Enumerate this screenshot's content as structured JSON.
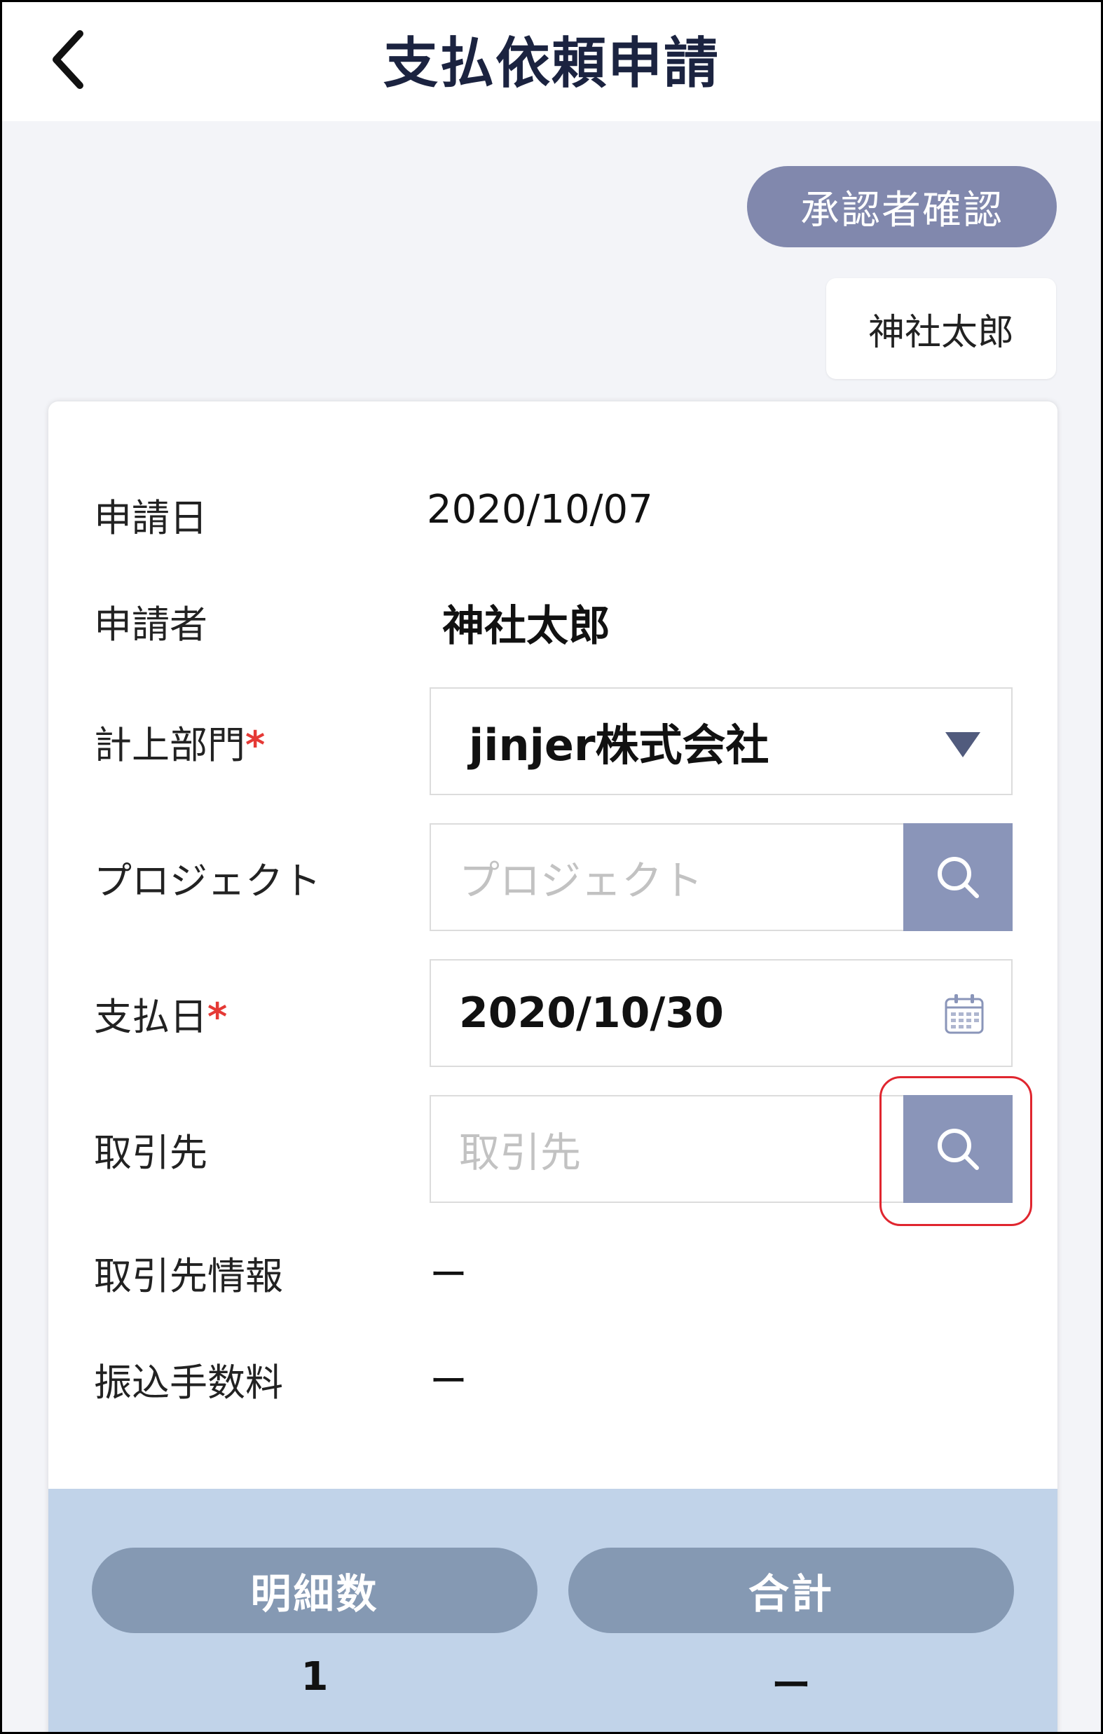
{
  "header": {
    "title": "支払依頼申請"
  },
  "approver": {
    "button_label": "承認者確認",
    "name": "神社太郎"
  },
  "form": {
    "application_date": {
      "label": "申請日",
      "value": "2020/10/07"
    },
    "applicant": {
      "label": "申請者",
      "value": "神社太郎"
    },
    "department": {
      "label": "計上部門",
      "required_mark": "*",
      "value": "jinjer株式会社"
    },
    "project": {
      "label": "プロジェクト",
      "placeholder": "プロジェクト"
    },
    "payment_date": {
      "label": "支払日",
      "required_mark": "*",
      "value": "2020/10/30"
    },
    "vendor": {
      "label": "取引先",
      "placeholder": "取引先"
    },
    "vendor_info": {
      "label": "取引先情報",
      "value": "ー"
    },
    "transfer_fee": {
      "label": "振込手数料",
      "value": "ー"
    }
  },
  "summary": {
    "items_label": "明細数",
    "items_value": "1",
    "total_label": "合計",
    "total_value": "ー"
  },
  "colors": {
    "accent": "#8a95b9",
    "approver_button": "#8188ad",
    "summary_band": "#c1d3e9",
    "highlight": "#e0262f",
    "required": "#e53935"
  },
  "icons": [
    "back-chevron-icon",
    "search-icon",
    "calendar-icon",
    "dropdown-triangle-icon"
  ]
}
